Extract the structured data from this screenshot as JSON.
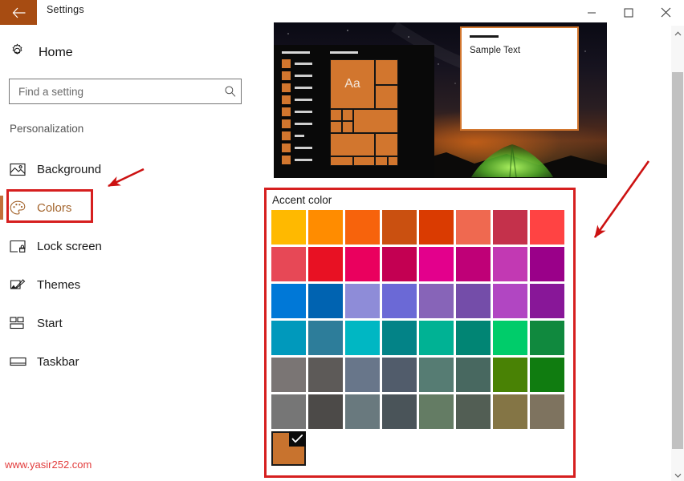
{
  "window": {
    "title": "Settings",
    "back_icon": "back-arrow-icon",
    "minimize_label": "—",
    "maximize_label": "□",
    "close_label": "✕"
  },
  "nav": {
    "home_label": "Home",
    "home_icon": "gear-icon",
    "search": {
      "placeholder": "Find a setting",
      "value": "",
      "icon": "search-icon"
    },
    "category": "Personalization",
    "items": [
      {
        "label": "Background",
        "icon": "picture-icon",
        "selected": false
      },
      {
        "label": "Colors",
        "icon": "palette-icon",
        "selected": true
      },
      {
        "label": "Lock screen",
        "icon": "lock-screen-icon",
        "selected": false
      },
      {
        "label": "Themes",
        "icon": "themes-brush-icon",
        "selected": false
      },
      {
        "label": "Start",
        "icon": "start-tiles-icon",
        "selected": false
      },
      {
        "label": "Taskbar",
        "icon": "taskbar-icon",
        "selected": false
      }
    ]
  },
  "preview": {
    "tile_letter": "Aa",
    "sample_window_text": "Sample Text"
  },
  "accent": {
    "heading": "Accent color",
    "selected_index": 48,
    "selected_color": "#c8732e",
    "check_icon": "checkmark-icon",
    "swatches": [
      [
        "#ffb900",
        "#ff8c00",
        "#f7630c",
        "#ca5010",
        "#da3b01",
        "#ef6950",
        "#c4314b",
        "#ff4343"
      ],
      [
        "#e74856",
        "#e81123",
        "#ea005e",
        "#c30052",
        "#e3008c",
        "#bf0077",
        "#c239b3",
        "#9a0089"
      ],
      [
        "#0078d7",
        "#0063b1",
        "#8e8cd8",
        "#6b69d6",
        "#8764b8",
        "#744da9",
        "#b146c2",
        "#881798"
      ],
      [
        "#0099bc",
        "#2d7d9a",
        "#00b7c3",
        "#038387",
        "#00b294",
        "#018574",
        "#00cc6a",
        "#10893e"
      ],
      [
        "#7a7574",
        "#5d5a58",
        "#68768a",
        "#515c6b",
        "#567c73",
        "#486860",
        "#498205",
        "#107c10"
      ],
      [
        "#767676",
        "#4c4a48",
        "#69797e",
        "#4a5459",
        "#647c64",
        "#525e54",
        "#847545",
        "#7e735f"
      ],
      [
        "#c8732e"
      ]
    ]
  },
  "scrollbar": {
    "up_arrow_icon": "chevron-up-icon",
    "down_arrow_icon": "chevron-down-icon"
  },
  "annotations": {
    "watermark": "www.yasir252.com",
    "accent_color": "#d61f1f",
    "arrow_to_colors": "red-arrow-icon",
    "arrow_to_accent_panel": "red-arrow-icon"
  }
}
